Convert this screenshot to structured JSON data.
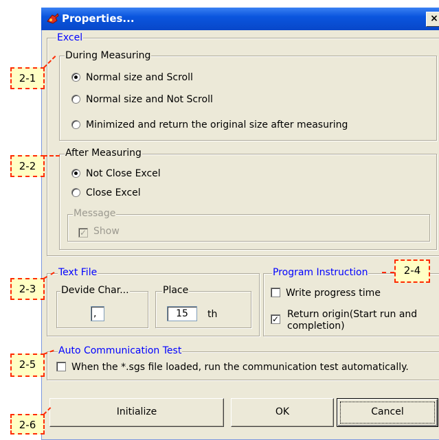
{
  "window": {
    "title": "Properties...",
    "close_symbol": "×"
  },
  "excel": {
    "legend": "Excel",
    "during": {
      "legend": "During Measuring",
      "options": [
        {
          "label": "Normal size and Scroll",
          "checked": true
        },
        {
          "label": "Normal size and Not Scroll",
          "checked": false
        },
        {
          "label": "Minimized and return the original size after measuring",
          "checked": false
        }
      ]
    },
    "after": {
      "legend": "After Measuring",
      "options": [
        {
          "label": "Not Close Excel",
          "checked": true
        },
        {
          "label": "Close Excel",
          "checked": false
        }
      ],
      "message": {
        "legend": "Message",
        "show_label": "Show",
        "show_checked": true,
        "disabled": true
      }
    }
  },
  "text_file": {
    "legend": "Text File",
    "divide_char": {
      "legend": "Devide Char...",
      "value": ","
    },
    "place": {
      "legend": "Place",
      "value": "15",
      "suffix": "th"
    }
  },
  "program_instruction": {
    "legend": "Program Instruction",
    "write_progress": {
      "label": "Write progress time",
      "checked": false
    },
    "return_origin": {
      "label_line1": "Return origin(Start run and",
      "label_line2": "completion)",
      "checked": true
    }
  },
  "auto_comm": {
    "legend": "Auto Communication Test",
    "label": "When the *.sgs file loaded, run the communication test automatically.",
    "checked": false
  },
  "buttons": {
    "initialize": "Initialize",
    "ok": "OK",
    "cancel": "Cancel"
  },
  "callouts": [
    "2-1",
    "2-2",
    "2-3",
    "2-4",
    "2-5",
    "2-6"
  ],
  "colors": {
    "callout_border": "#ff2a00",
    "callout_fill": "#ffffc4",
    "legend_blue": "#0000ff",
    "titlebar": "#0a55de",
    "dialog_bg": "#ece9d8"
  }
}
